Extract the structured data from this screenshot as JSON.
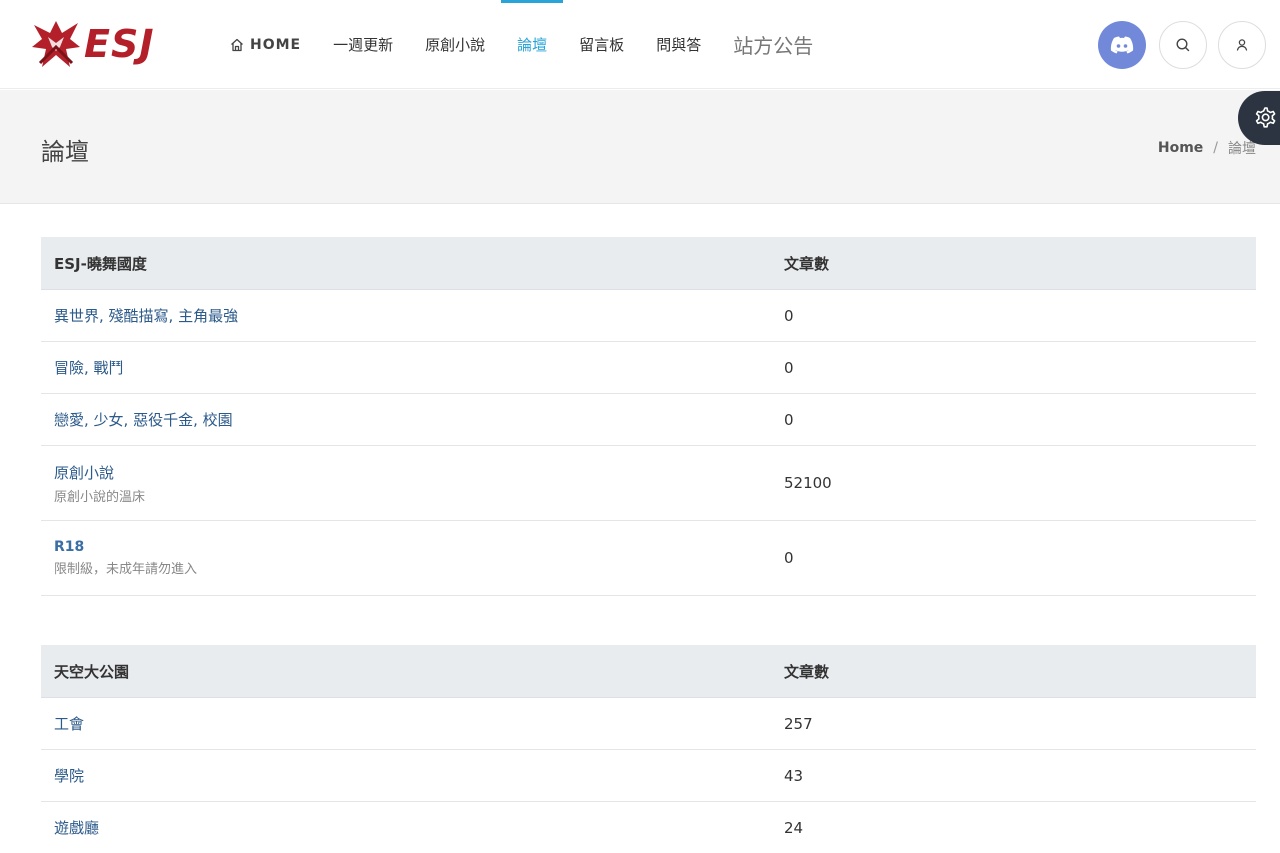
{
  "header": {
    "logo_text": "ESJ",
    "nav": [
      {
        "label": "HOME"
      },
      {
        "label": "一週更新"
      },
      {
        "label": "原創小說"
      },
      {
        "label": "論壇"
      },
      {
        "label": "留言板"
      },
      {
        "label": "問與答"
      },
      {
        "label": "站方公告"
      }
    ],
    "active_nav": "論壇",
    "accent_color": "#2aa3d8",
    "discord_color": "#7289da"
  },
  "titlebar": {
    "title": "論壇",
    "breadcrumb": {
      "home": "Home",
      "separator": "/",
      "current": "論壇"
    }
  },
  "sections": [
    {
      "header_name": "ESJ-曉舞國度",
      "header_count": "文章數",
      "rows": [
        {
          "name": "異世界, 殘酷描寫, 主角最強",
          "desc": "",
          "count": "0"
        },
        {
          "name": "冒險, 戰鬥",
          "desc": "",
          "count": "0"
        },
        {
          "name": "戀愛, 少女, 惡役千金, 校園",
          "desc": "",
          "count": "0"
        },
        {
          "name": "原創小說",
          "desc": "原創小說的溫床",
          "count": "52100"
        },
        {
          "name": "R18",
          "desc": "限制級，未成年請勿進入",
          "count": "0"
        }
      ]
    },
    {
      "header_name": "天空大公園",
      "header_count": "文章數",
      "rows": [
        {
          "name": "工會",
          "desc": "",
          "count": "257"
        },
        {
          "name": "學院",
          "desc": "",
          "count": "43"
        },
        {
          "name": "遊戲廳",
          "desc": "",
          "count": "24"
        }
      ]
    }
  ]
}
